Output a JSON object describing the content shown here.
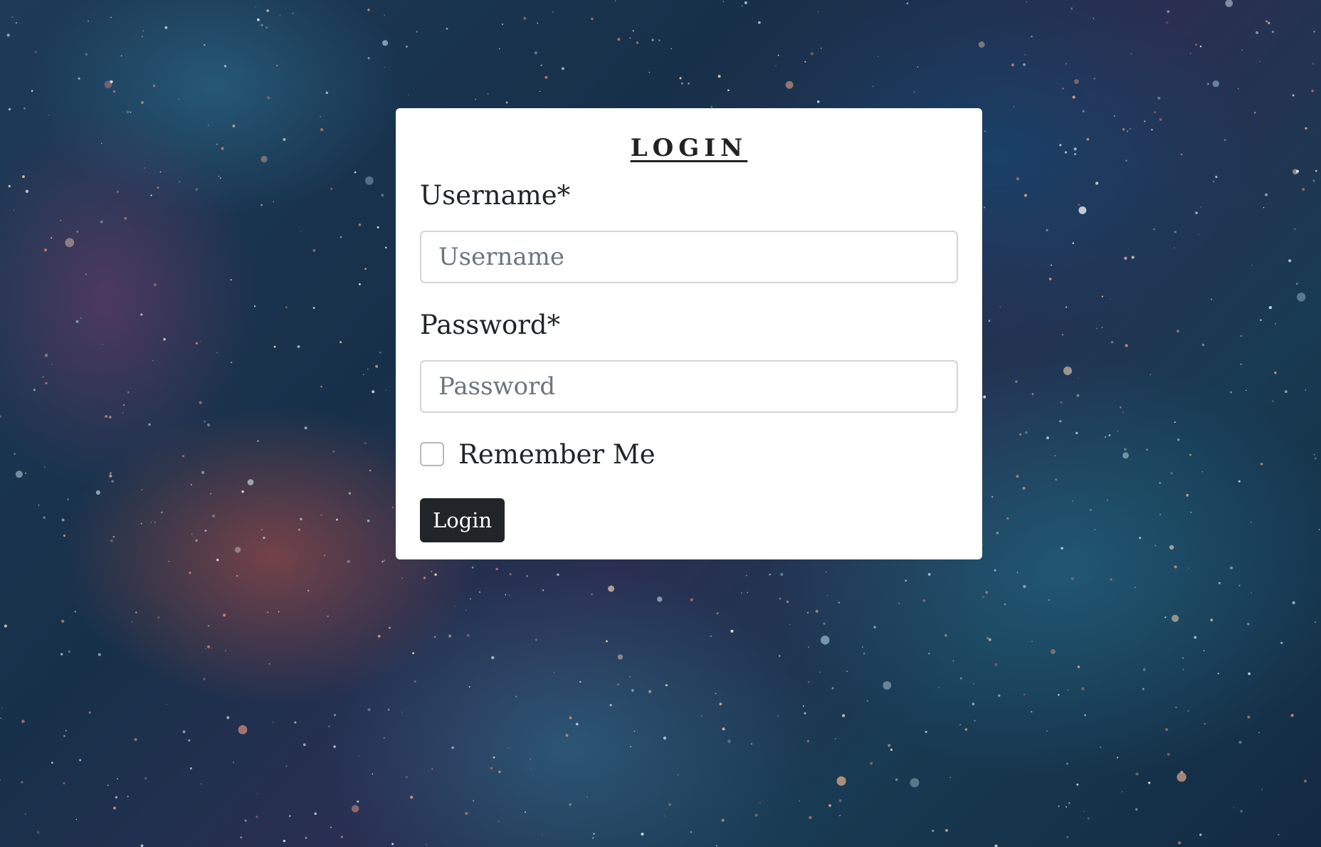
{
  "login_form": {
    "title": "LOGIN",
    "username_label": "Username*",
    "username_placeholder": "Username",
    "username_value": "",
    "password_label": "Password*",
    "password_placeholder": "Password",
    "password_value": "",
    "remember_label": "Remember Me",
    "remember_checked": false,
    "submit_label": "Login"
  },
  "colors": {
    "card_background": "#ffffff",
    "button_background": "#212529",
    "button_text": "#ffffff",
    "text": "#212529",
    "placeholder": "#6c757d"
  },
  "background": {
    "type": "starry-nebula-texture"
  }
}
